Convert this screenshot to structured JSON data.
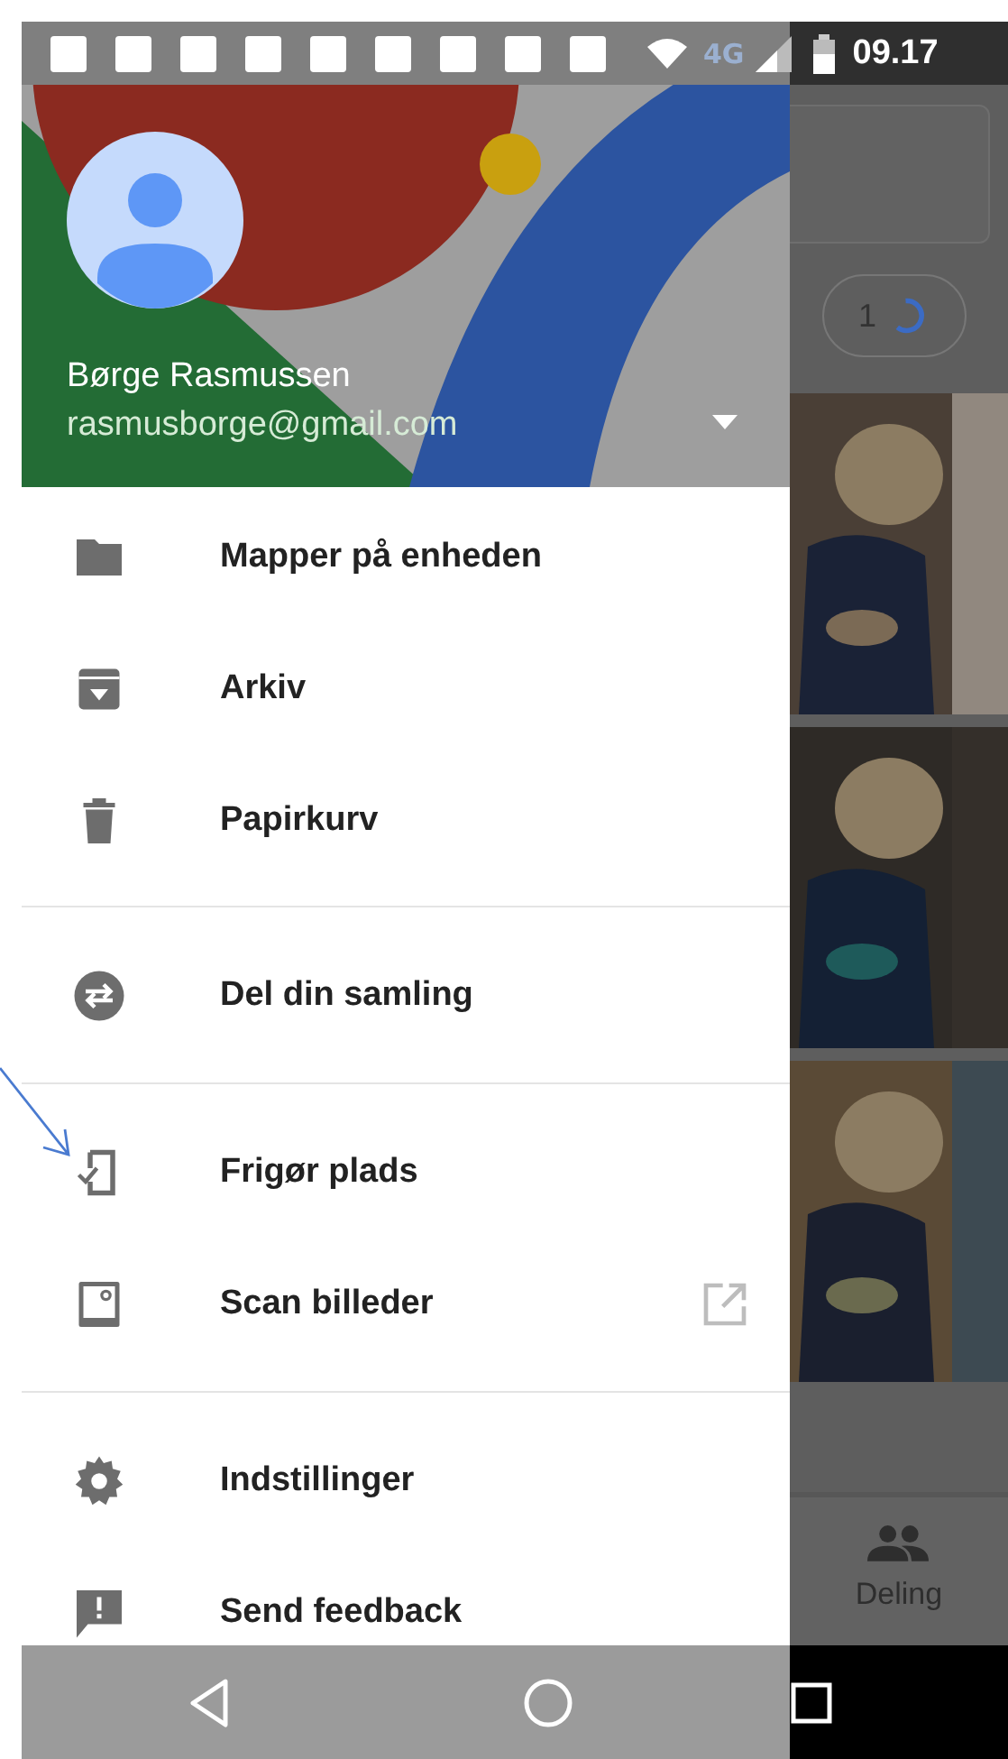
{
  "status_bar": {
    "network": "4G",
    "time": "09.17"
  },
  "account": {
    "name": "Børge Rasmussen",
    "email": "rasmusborge@gmail.com"
  },
  "menu": [
    [
      {
        "label": "Mapper på enheden",
        "external": false
      },
      {
        "label": "Arkiv",
        "external": false
      },
      {
        "label": "Papirkurv",
        "external": false
      }
    ],
    [
      {
        "label": "Del din samling",
        "external": false
      }
    ],
    [
      {
        "label": "Frigør plads",
        "external": false
      },
      {
        "label": "Scan billeder",
        "external": true
      }
    ],
    [
      {
        "label": "Indstillinger",
        "external": false
      },
      {
        "label": "Send feedback",
        "external": false
      }
    ]
  ],
  "background": {
    "counter": "1",
    "bottom_tab": "Deling"
  }
}
